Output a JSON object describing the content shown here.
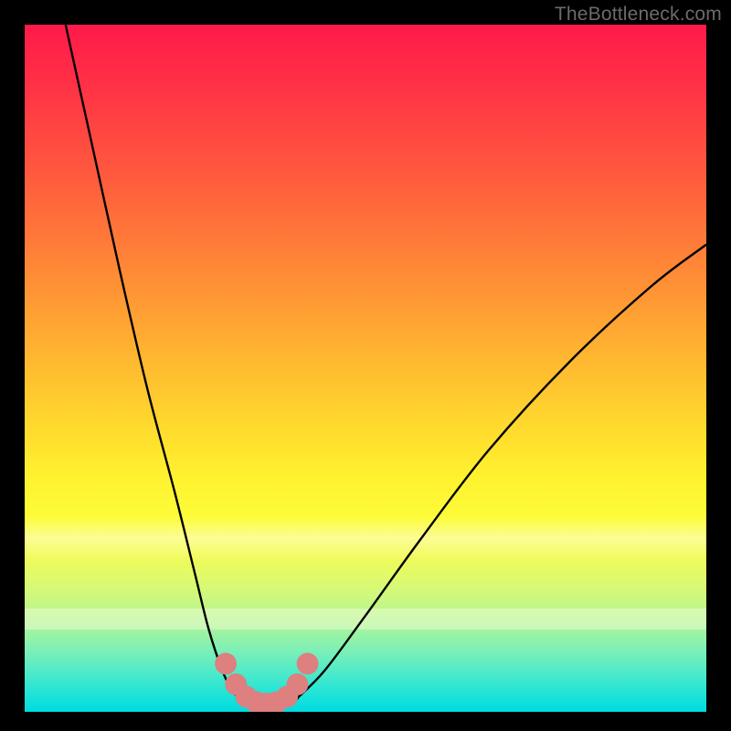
{
  "watermark": "TheBottleneck.com",
  "colors": {
    "frame": "#000000",
    "curve": "#000000",
    "marker": "#de7f80",
    "gradient_top": "#ff1a4a",
    "gradient_bottom": "#00dbe0"
  },
  "chart_data": {
    "type": "line",
    "title": "",
    "xlabel": "",
    "ylabel": "",
    "xlim": [
      0,
      100
    ],
    "ylim": [
      0,
      100
    ],
    "grid": false,
    "legend": false,
    "note": "Axes are unlabeled; values below are estimated as percent of plot width (x) and percent of plot height from bottom (y).",
    "series": [
      {
        "name": "left-branch",
        "x": [
          6,
          10,
          14,
          18,
          22,
          25,
          27,
          29,
          30.5,
          32
        ],
        "y": [
          100,
          82,
          64,
          47,
          32,
          20,
          12,
          6,
          3,
          1.5
        ]
      },
      {
        "name": "valley",
        "x": [
          32,
          34,
          36,
          38,
          40
        ],
        "y": [
          1.5,
          1,
          1,
          1.2,
          2
        ]
      },
      {
        "name": "right-branch",
        "x": [
          40,
          44,
          50,
          58,
          68,
          80,
          92,
          100
        ],
        "y": [
          2,
          6,
          14,
          25,
          38,
          51,
          62,
          68
        ]
      }
    ],
    "markers": {
      "name": "highlight-dots",
      "x": [
        29.5,
        31,
        32.5,
        34,
        35.5,
        37,
        38.5,
        40,
        41.5
      ],
      "y": [
        7,
        4,
        2.2,
        1.4,
        1.2,
        1.4,
        2.2,
        4,
        7
      ],
      "r_percent": 1.6,
      "color": "#de7f80"
    }
  }
}
